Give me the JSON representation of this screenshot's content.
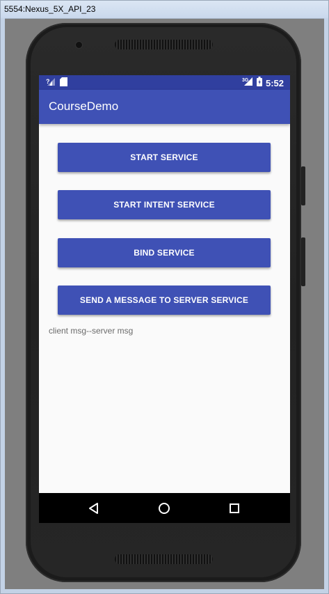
{
  "window": {
    "title": "5554:Nexus_5X_API_23"
  },
  "statusbar": {
    "time": "5:52",
    "left_icons": [
      "signal-question-icon",
      "sd-card-icon"
    ],
    "right_icons": [
      "signal-3g-icon",
      "battery-icon"
    ],
    "network_label": "3G"
  },
  "appbar": {
    "title": "CourseDemo",
    "color": "#3f51b5",
    "status_color": "#303f9f"
  },
  "buttons": [
    {
      "label": "START SERVICE"
    },
    {
      "label": "START INTENT SERVICE"
    },
    {
      "label": "BIND SERVICE"
    },
    {
      "label": "SEND A MESSAGE TO SERVER SERVICE"
    }
  ],
  "message": {
    "text": "client msg--server msg"
  },
  "navbar": {
    "items": [
      "back-icon",
      "home-icon",
      "recents-icon"
    ]
  }
}
